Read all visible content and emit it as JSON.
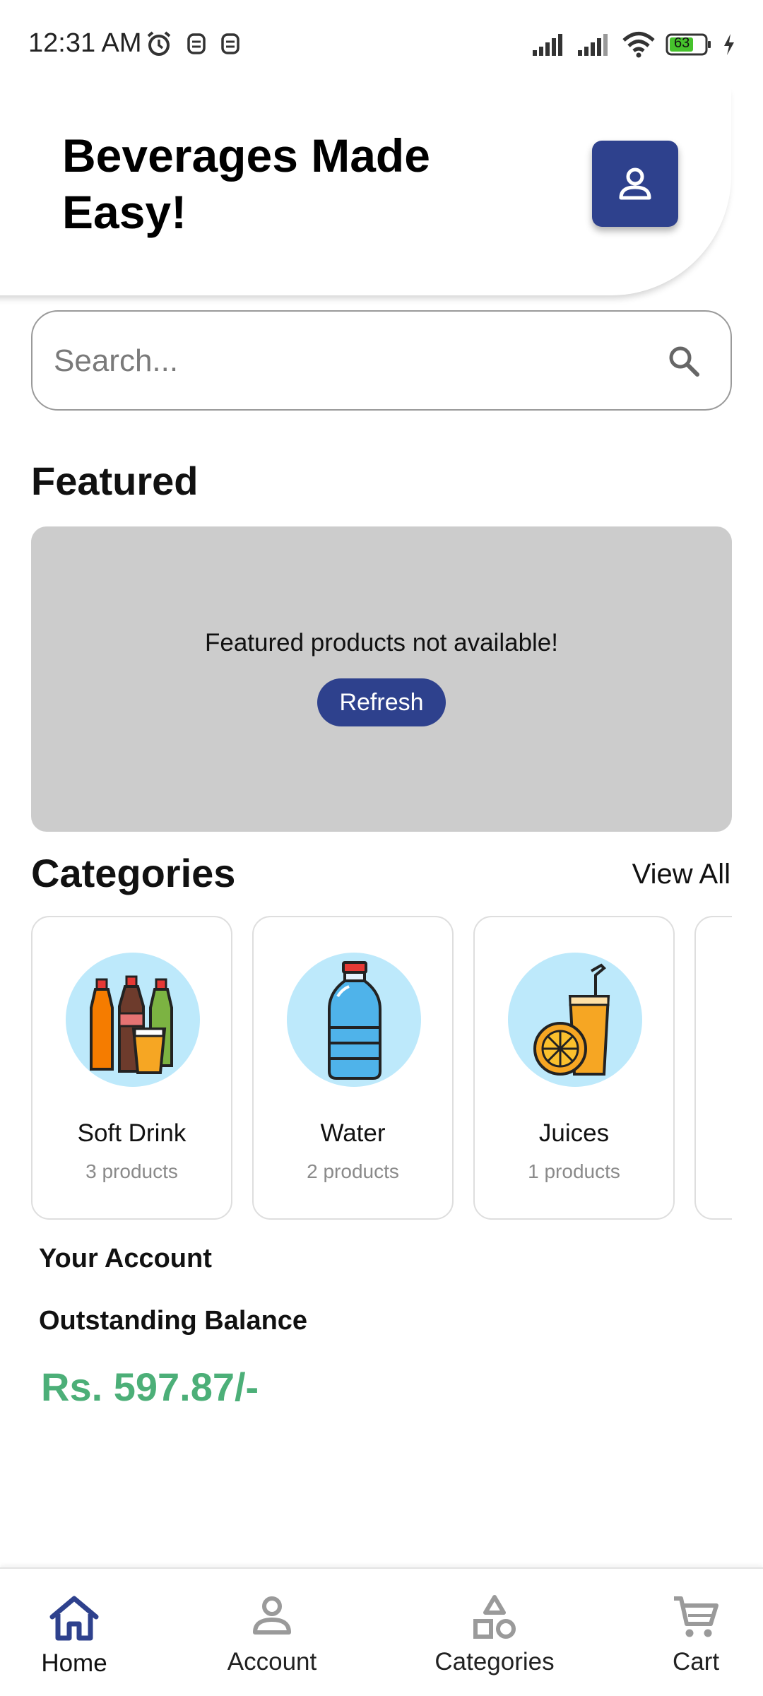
{
  "status_bar": {
    "time": "12:31 AM",
    "battery": "63",
    "icons": [
      "alarm-icon",
      "notification-icon",
      "notification-icon",
      "signal-icon",
      "signal-icon",
      "wifi-icon",
      "battery-icon",
      "charging-icon"
    ]
  },
  "header": {
    "title": "Beverages Made Easy!",
    "profile_icon": "user-icon"
  },
  "search": {
    "placeholder": "Search...",
    "icon": "search-icon"
  },
  "featured": {
    "title": "Featured",
    "message": "Featured products not available!",
    "refresh_label": "Refresh"
  },
  "categories": {
    "title": "Categories",
    "view_all_label": "View All",
    "items": [
      {
        "name": "Soft Drink",
        "count": "3 products",
        "icon": "soft-drink-bottles-icon"
      },
      {
        "name": "Water",
        "count": "2 products",
        "icon": "water-bottle-icon"
      },
      {
        "name": "Juices",
        "count": "1 products",
        "icon": "juice-glass-icon"
      }
    ]
  },
  "account": {
    "title": "Your Account",
    "balance_label": "Outstanding Balance",
    "balance_amount": "Rs. 597.87/-"
  },
  "bottom_nav": {
    "items": [
      {
        "label": "Home",
        "icon": "home-icon",
        "active": true
      },
      {
        "label": "Account",
        "icon": "user-icon",
        "active": false
      },
      {
        "label": "Categories",
        "icon": "shapes-icon",
        "active": false
      },
      {
        "label": "Cart",
        "icon": "cart-icon",
        "active": false
      }
    ]
  },
  "colors": {
    "primary": "#2e418d",
    "balance": "#4caf78",
    "panel_gray": "#cccccc",
    "category_circle": "#bde9fb"
  }
}
